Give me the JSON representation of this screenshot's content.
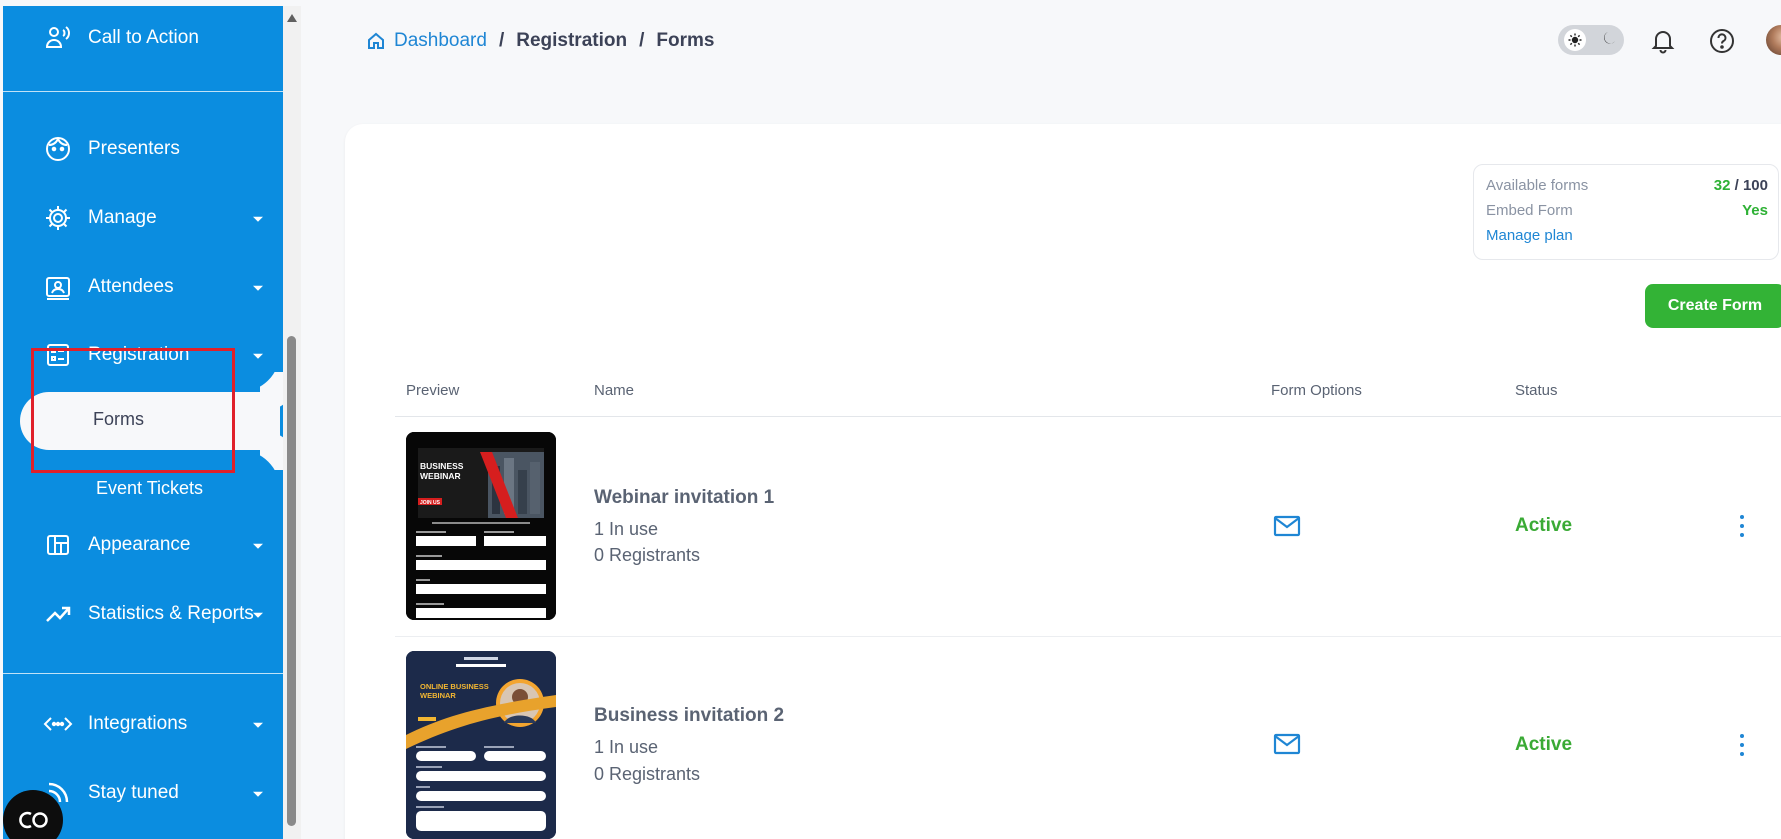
{
  "sidebar": {
    "items": [
      {
        "label": "Call to Action",
        "icon": "megaphone-person-icon"
      },
      {
        "label": "Presenters",
        "icon": "face-icon"
      },
      {
        "label": "Manage",
        "icon": "gear-icon"
      },
      {
        "label": "Attendees",
        "icon": "id-card-icon"
      },
      {
        "label": "Registration",
        "icon": "form-list-icon"
      },
      {
        "label": "Appearance",
        "icon": "layout-icon"
      },
      {
        "label": "Statistics & Reports",
        "icon": "trend-up-icon"
      },
      {
        "label": "Integrations",
        "icon": "code-arrows-icon"
      },
      {
        "label": "Stay tuned",
        "icon": "broadcast-icon"
      }
    ],
    "sub_items": {
      "active": "Forms",
      "other": "Event Tickets"
    }
  },
  "breadcrumb": {
    "home": "Dashboard",
    "separator": "/",
    "level2": "Registration",
    "level3": "Forms"
  },
  "plan": {
    "available_label": "Available forms",
    "available_used": "32",
    "available_total": "/ 100",
    "embed_label": "Embed Form",
    "embed_value": "Yes",
    "manage_link": "Manage plan"
  },
  "actions": {
    "create_form": "Create Form"
  },
  "table": {
    "columns": [
      "Preview",
      "Name",
      "Form Options",
      "Status"
    ],
    "rows": [
      {
        "name": "Webinar invitation 1",
        "in_use": "1 In use",
        "registrants": "0 Registrants",
        "status": "Active"
      },
      {
        "name": "Business invitation 2",
        "in_use": "1 In use",
        "registrants": "0 Registrants",
        "status": "Active"
      }
    ]
  },
  "previews": {
    "first": {
      "title": "BUSINESS WEBINAR",
      "cta": "JOIN US"
    },
    "second": {
      "title": "ONLINE BUSINESS WEBINAR"
    }
  },
  "colors": {
    "sidebar_bg": "#0b8de0",
    "link_blue": "#1f86d4",
    "success_green": "#33b336",
    "highlight_red": "#e0202a"
  }
}
